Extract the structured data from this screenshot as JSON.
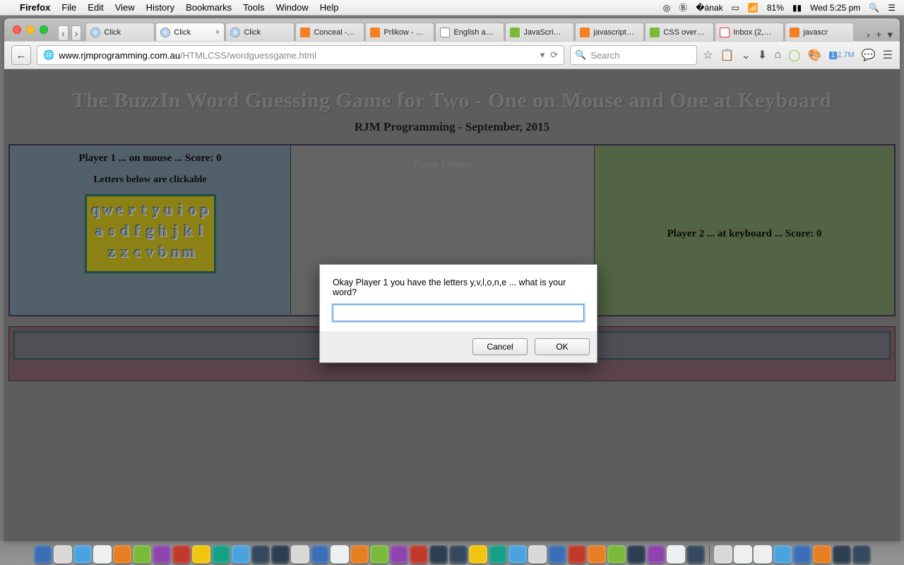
{
  "mac_menu": {
    "apple": "",
    "app": "Firefox",
    "items": [
      "File",
      "Edit",
      "View",
      "History",
      "Bookmarks",
      "Tools",
      "Window",
      "Help"
    ],
    "battery_pct": "81%",
    "clock": "Wed 5:25 pm"
  },
  "tabs": [
    {
      "label": "Click",
      "active": false,
      "favicon": "globe"
    },
    {
      "label": "Click",
      "active": true,
      "favicon": "globe"
    },
    {
      "label": "Click",
      "active": false,
      "favicon": "globe"
    },
    {
      "label": "Conceal -…",
      "active": false,
      "favicon": "stack"
    },
    {
      "label": "Prlikow - …",
      "active": false,
      "favicon": "stack"
    },
    {
      "label": "English a…",
      "active": false,
      "favicon": "wiki"
    },
    {
      "label": "JavaScri…",
      "active": false,
      "favicon": "w3"
    },
    {
      "label": "javascript…",
      "active": false,
      "favicon": "stack"
    },
    {
      "label": "CSS over…",
      "active": false,
      "favicon": "w3"
    },
    {
      "label": "Inbox (2,…",
      "active": false,
      "favicon": "gm"
    },
    {
      "label": "javascr",
      "active": false,
      "favicon": "stack"
    }
  ],
  "url": {
    "full": "www.rjmprogramming.com.au/HTMLCSS/wordguessgame.html",
    "domain": "www.rjmprogramming.com.au",
    "path": "/HTMLCSS/wordguessgame.html"
  },
  "search_placeholder": "Search",
  "toolbar_badge": "2.7M",
  "toolbar_badge_count": "1",
  "page": {
    "title": "The BuzzIn Word Guessing Game for Two - One on Mouse and One at Keyboard",
    "subtitle": "RJM Programming - September, 2015",
    "p1_score": "Player 1 ... on mouse ... Score: 0",
    "p1_hint": "Letters below are clickable",
    "p2_score": "Player 2 ... at keyboard ... Score: 0",
    "hidden_label_top": "Player 1 Name",
    "hidden_label_bottom": "",
    "kbd_rows": [
      [
        "q",
        "w",
        "e",
        "r",
        "t",
        "y",
        "u",
        "i",
        "o",
        "p"
      ],
      [
        "a",
        "s",
        "d",
        "f",
        "g",
        "h",
        "j",
        "k",
        "l"
      ],
      [
        "z",
        "x",
        "c",
        "v",
        "b",
        "n",
        "m"
      ]
    ],
    "current_letters": "yvlone"
  },
  "dialog": {
    "message": "Okay Player 1 you have the letters y,v,l,o,n,e ... what is your word?",
    "value": "",
    "cancel": "Cancel",
    "ok": "OK"
  }
}
